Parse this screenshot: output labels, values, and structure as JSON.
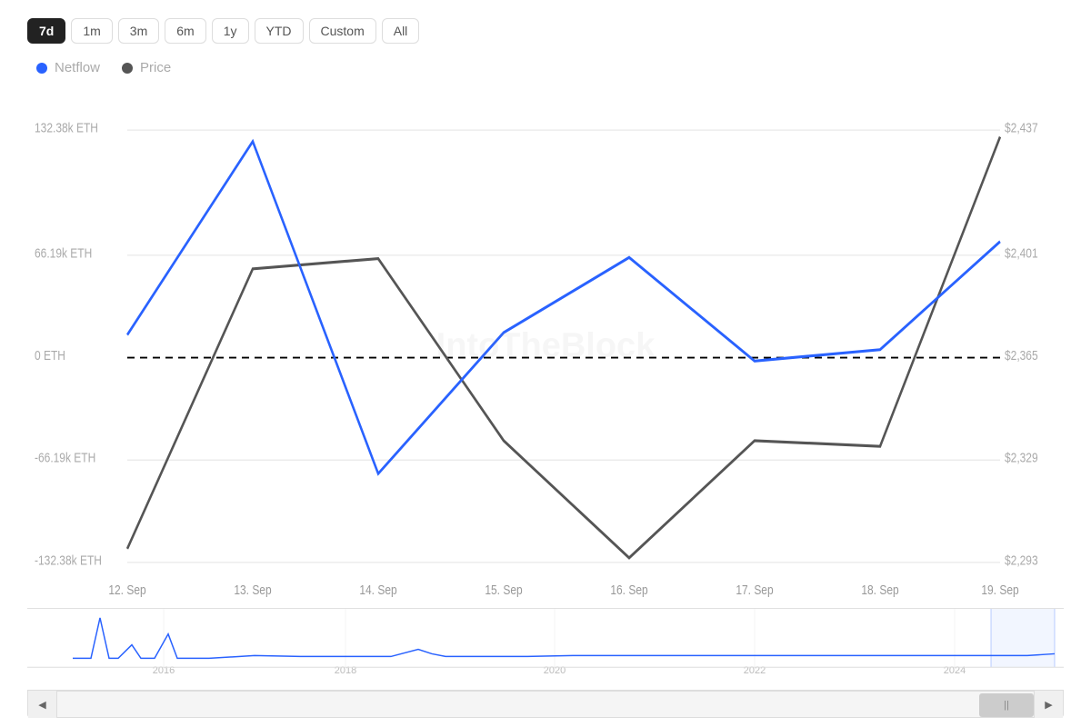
{
  "timeRange": {
    "buttons": [
      "7d",
      "1m",
      "3m",
      "6m",
      "1y",
      "YTD",
      "Custom",
      "All"
    ],
    "active": "7d"
  },
  "legend": {
    "items": [
      {
        "label": "Netflow",
        "color": "blue"
      },
      {
        "label": "Price",
        "color": "dark"
      }
    ]
  },
  "chart": {
    "leftAxis": {
      "labels": [
        "132.38k ETH",
        "66.19k ETH",
        "0 ETH",
        "-66.19k ETH",
        "-132.38k ETH"
      ]
    },
    "rightAxis": {
      "labels": [
        "$2,437",
        "$2,401",
        "$2,365",
        "$2,329",
        "$2,293"
      ]
    },
    "xAxis": {
      "labels": [
        "12. Sep",
        "13. Sep",
        "14. Sep",
        "15. Sep",
        "16. Sep",
        "17. Sep",
        "18. Sep",
        "19. Sep"
      ]
    },
    "miniAxis": {
      "labels": [
        "2016",
        "2018",
        "2020",
        "2022",
        "2024"
      ]
    }
  },
  "watermark": "IntoTheBlock",
  "scrollbar": {
    "left_arrow": "◀",
    "right_arrow": "▶",
    "handle": "||"
  }
}
